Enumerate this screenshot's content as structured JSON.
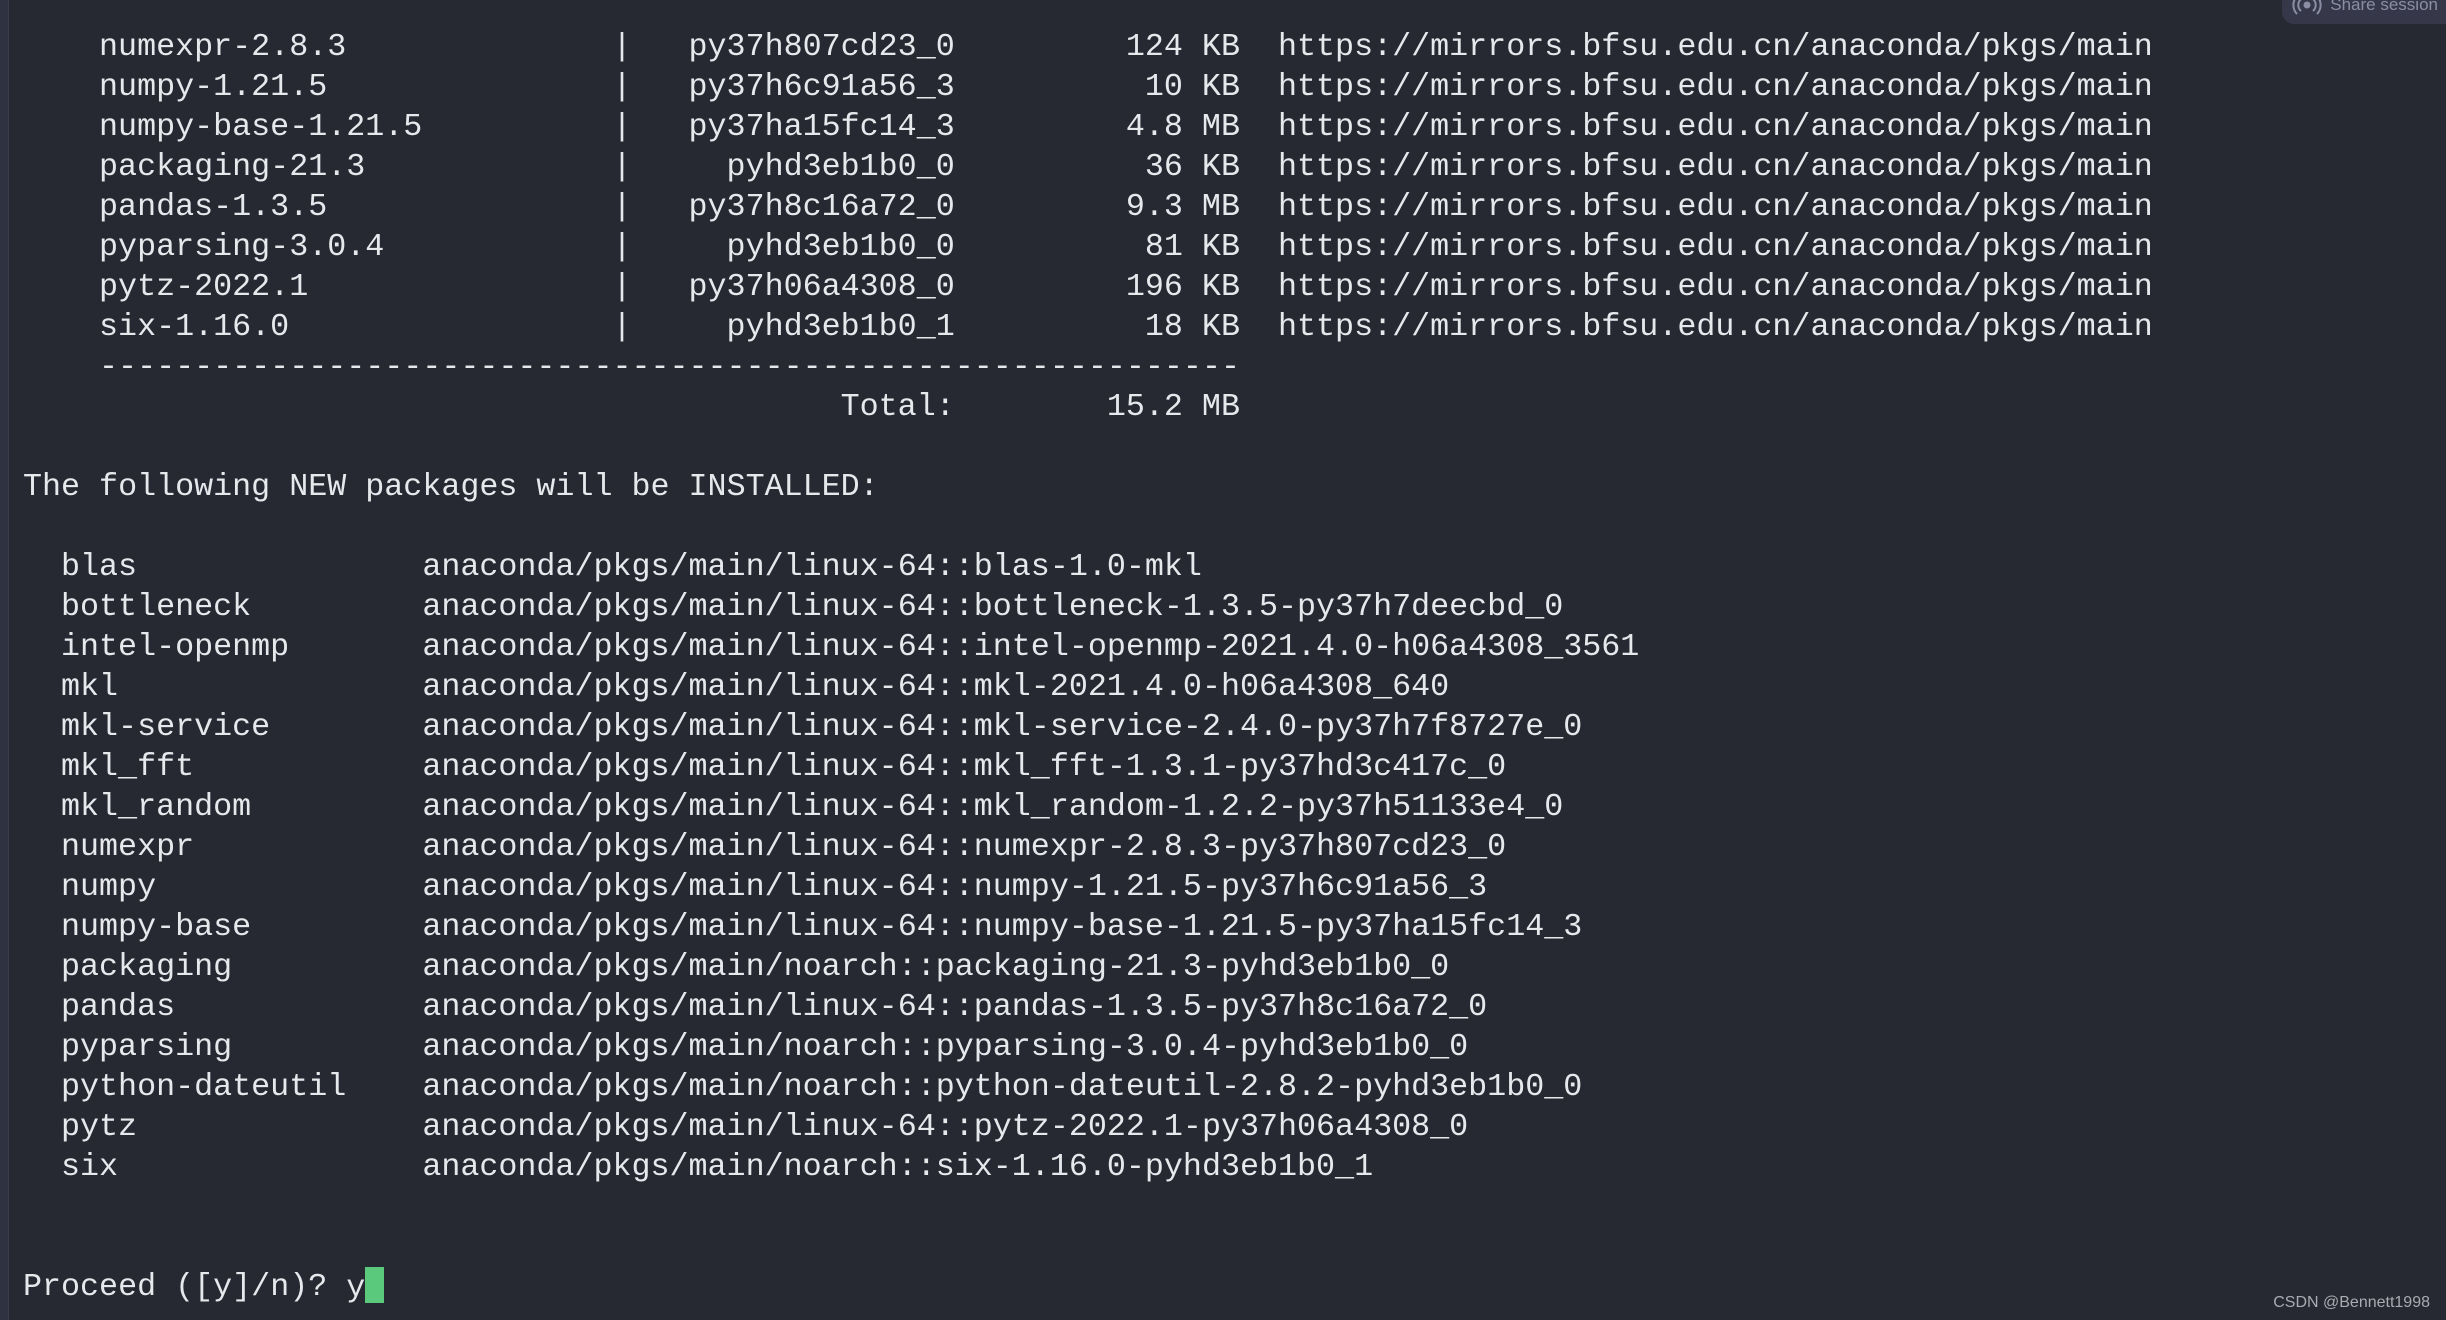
{
  "download_table": {
    "rows": [
      {
        "package": "numexpr-2.8.3",
        "build": "py37h807cd23_0",
        "size": "124 KB",
        "channel": "https://mirrors.bfsu.edu.cn/anaconda/pkgs/main"
      },
      {
        "package": "numpy-1.21.5",
        "build": "py37h6c91a56_3",
        "size": "10 KB",
        "channel": "https://mirrors.bfsu.edu.cn/anaconda/pkgs/main"
      },
      {
        "package": "numpy-base-1.21.5",
        "build": "py37ha15fc14_3",
        "size": "4.8 MB",
        "channel": "https://mirrors.bfsu.edu.cn/anaconda/pkgs/main"
      },
      {
        "package": "packaging-21.3",
        "build": "pyhd3eb1b0_0",
        "size": "36 KB",
        "channel": "https://mirrors.bfsu.edu.cn/anaconda/pkgs/main"
      },
      {
        "package": "pandas-1.3.5",
        "build": "py37h8c16a72_0",
        "size": "9.3 MB",
        "channel": "https://mirrors.bfsu.edu.cn/anaconda/pkgs/main"
      },
      {
        "package": "pyparsing-3.0.4",
        "build": "pyhd3eb1b0_0",
        "size": "81 KB",
        "channel": "https://mirrors.bfsu.edu.cn/anaconda/pkgs/main"
      },
      {
        "package": "pytz-2022.1",
        "build": "py37h06a4308_0",
        "size": "196 KB",
        "channel": "https://mirrors.bfsu.edu.cn/anaconda/pkgs/main"
      },
      {
        "package": "six-1.16.0",
        "build": "pyhd3eb1b0_1",
        "size": "18 KB",
        "channel": "https://mirrors.bfsu.edu.cn/anaconda/pkgs/main"
      }
    ],
    "separator": "|",
    "rule": "------------------------------------------------------------",
    "total_label": "Total:",
    "total_size": "15.2 MB"
  },
  "install": {
    "header": "The following NEW packages will be INSTALLED:",
    "rows": [
      {
        "name": "blas",
        "spec": "anaconda/pkgs/main/linux-64::blas-1.0-mkl"
      },
      {
        "name": "bottleneck",
        "spec": "anaconda/pkgs/main/linux-64::bottleneck-1.3.5-py37h7deecbd_0"
      },
      {
        "name": "intel-openmp",
        "spec": "anaconda/pkgs/main/linux-64::intel-openmp-2021.4.0-h06a4308_3561"
      },
      {
        "name": "mkl",
        "spec": "anaconda/pkgs/main/linux-64::mkl-2021.4.0-h06a4308_640"
      },
      {
        "name": "mkl-service",
        "spec": "anaconda/pkgs/main/linux-64::mkl-service-2.4.0-py37h7f8727e_0"
      },
      {
        "name": "mkl_fft",
        "spec": "anaconda/pkgs/main/linux-64::mkl_fft-1.3.1-py37hd3c417c_0"
      },
      {
        "name": "mkl_random",
        "spec": "anaconda/pkgs/main/linux-64::mkl_random-1.2.2-py37h51133e4_0"
      },
      {
        "name": "numexpr",
        "spec": "anaconda/pkgs/main/linux-64::numexpr-2.8.3-py37h807cd23_0"
      },
      {
        "name": "numpy",
        "spec": "anaconda/pkgs/main/linux-64::numpy-1.21.5-py37h6c91a56_3"
      },
      {
        "name": "numpy-base",
        "spec": "anaconda/pkgs/main/linux-64::numpy-base-1.21.5-py37ha15fc14_3"
      },
      {
        "name": "packaging",
        "spec": "anaconda/pkgs/main/noarch::packaging-21.3-pyhd3eb1b0_0"
      },
      {
        "name": "pandas",
        "spec": "anaconda/pkgs/main/linux-64::pandas-1.3.5-py37h8c16a72_0"
      },
      {
        "name": "pyparsing",
        "spec": "anaconda/pkgs/main/noarch::pyparsing-3.0.4-pyhd3eb1b0_0"
      },
      {
        "name": "python-dateutil",
        "spec": "anaconda/pkgs/main/noarch::python-dateutil-2.8.2-pyhd3eb1b0_0"
      },
      {
        "name": "pytz",
        "spec": "anaconda/pkgs/main/linux-64::pytz-2022.1-py37h06a4308_0"
      },
      {
        "name": "six",
        "spec": "anaconda/pkgs/main/noarch::six-1.16.0-pyhd3eb1b0_1"
      }
    ]
  },
  "prompt": {
    "text": "Proceed ([y]/n)? ",
    "input": "y"
  },
  "share_button": {
    "label": "Share session",
    "icon": "broadcast-icon"
  },
  "watermark": "CSDN @Bennett1998",
  "colors": {
    "background": "#262932",
    "text": "#e6e8ec",
    "cursor": "#5bc97c"
  }
}
